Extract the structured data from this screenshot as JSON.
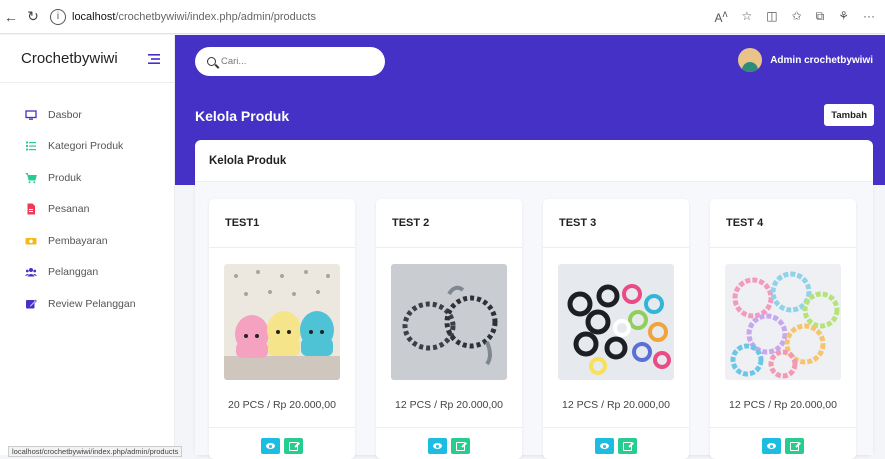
{
  "browser": {
    "url_host": "localhost",
    "url_path": "/crochetbywiwi/index.php/admin/products",
    "status_url": "localhost/crochetbywiwi/index.php/admin/products"
  },
  "sidebar": {
    "brand": "Crochetbywiwi",
    "items": [
      {
        "label": "Dasbor",
        "icon": "monitor-icon"
      },
      {
        "label": "Kategori Produk",
        "icon": "list-icon"
      },
      {
        "label": "Produk",
        "icon": "cart-icon"
      },
      {
        "label": "Pesanan",
        "icon": "document-icon"
      },
      {
        "label": "Pembayaran",
        "icon": "money-icon"
      },
      {
        "label": "Pelanggan",
        "icon": "users-icon"
      },
      {
        "label": "Review Pelanggan",
        "icon": "edit-icon"
      }
    ]
  },
  "header": {
    "search_placeholder": "Cari...",
    "user_name": "Admin crochetbywiwi",
    "page_title": "Kelola Produk",
    "add_button": "Tambah"
  },
  "card": {
    "title": "Kelola Produk"
  },
  "products": [
    {
      "name": "TEST1",
      "info": "20 PCS / Rp 20.000,00"
    },
    {
      "name": "TEST 2",
      "info": "12 PCS / Rp 20.000,00"
    },
    {
      "name": "TEST 3",
      "info": "12 PCS / Rp 20.000,00"
    },
    {
      "name": "TEST 4",
      "info": "12 PCS / Rp 20.000,00"
    }
  ],
  "colors": {
    "header": "#4631c7",
    "view_button": "#1cbde0",
    "edit_button": "#27cc8f"
  }
}
